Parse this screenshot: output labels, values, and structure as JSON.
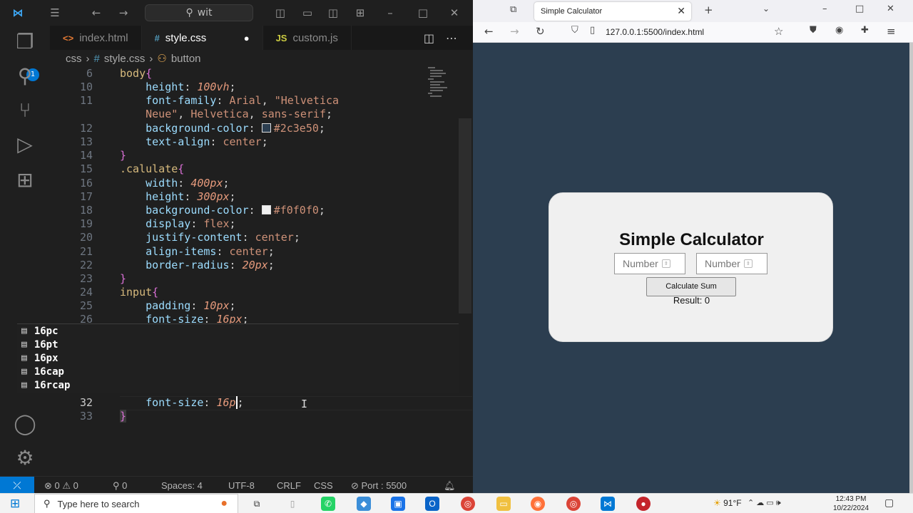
{
  "vscode": {
    "search_text": "wit",
    "activity_badge": "1",
    "tabs": [
      {
        "icon": "<>",
        "label": "index.html"
      },
      {
        "icon": "#",
        "label": "style.css"
      },
      {
        "icon": "JS",
        "label": "custom.js"
      }
    ],
    "breadcrumb": [
      "css",
      "#",
      "style.css",
      "button"
    ],
    "line_numbers": [
      "6",
      "10",
      "11",
      "",
      "12",
      "13",
      "14",
      "15",
      "16",
      "17",
      "18",
      "19",
      "20",
      "21",
      "22",
      "23",
      "24",
      "25",
      "26",
      "32",
      "33"
    ],
    "suggestions": [
      "16pc",
      "16pt",
      "16px",
      "16cap",
      "16rcap"
    ],
    "status": {
      "errors": "0",
      "warnings": "0",
      "ports": "0",
      "spaces": "Spaces: 4",
      "encoding": "UTF-8",
      "eol": "CRLF",
      "language": "CSS",
      "port": "Port : 5500"
    }
  },
  "browser": {
    "tab_title": "Simple Calculator",
    "url": "127.0.0.1:5500/index.html",
    "app": {
      "title": "Simple Calculator",
      "input1_placeholder": "Number",
      "input2_placeholder": "Number",
      "button_label": "Calculate Sum",
      "result": "Result: 0"
    },
    "page_background": "#2c3e50"
  },
  "taskbar": {
    "search_placeholder": "Type here to search",
    "weather": "91°F",
    "time": "12:43 PM",
    "date": "10/22/2024"
  }
}
